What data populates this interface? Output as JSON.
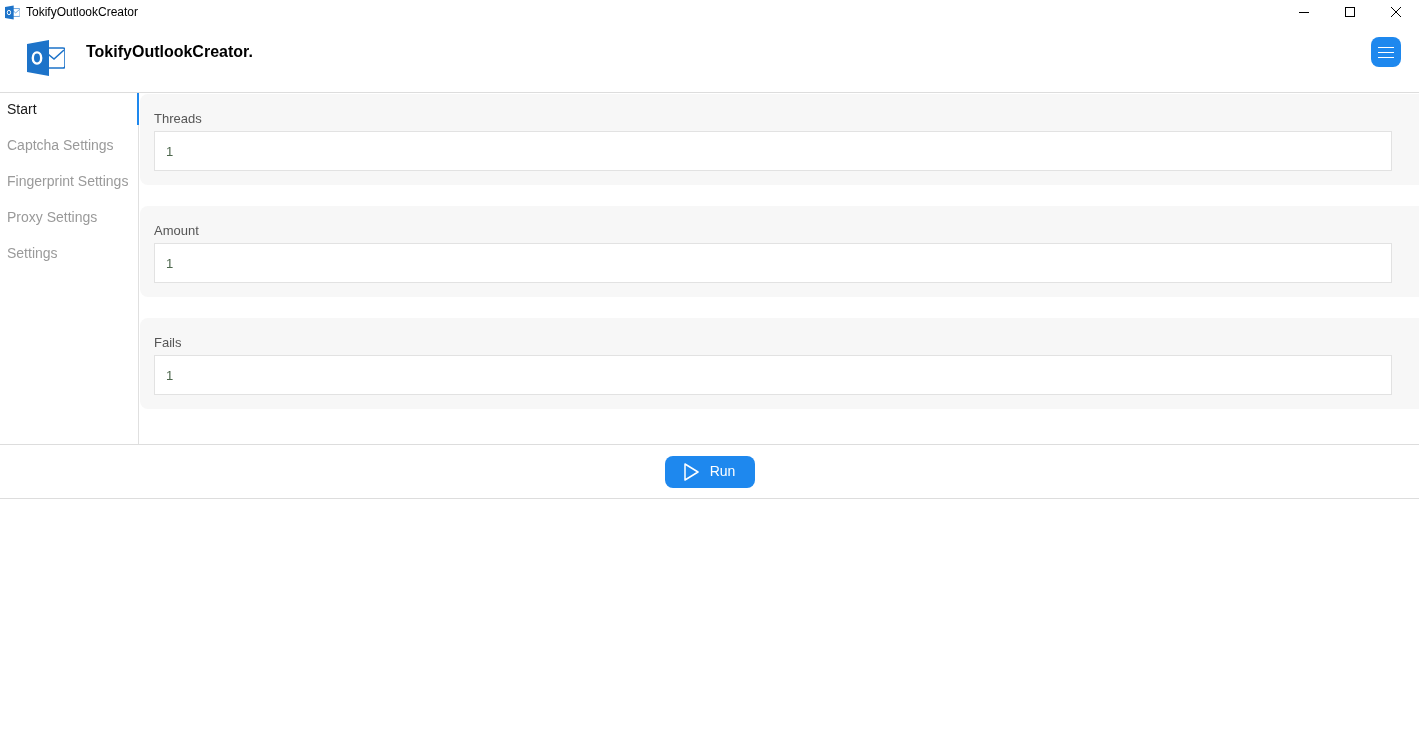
{
  "window": {
    "title": "TokifyOutlookCreator"
  },
  "header": {
    "app_name": "TokifyOutlookCreator."
  },
  "sidebar": {
    "items": [
      {
        "label": "Start",
        "selected": true
      },
      {
        "label": "Captcha Settings",
        "selected": false
      },
      {
        "label": "Fingerprint Settings",
        "selected": false
      },
      {
        "label": "Proxy Settings",
        "selected": false
      },
      {
        "label": "Settings",
        "selected": false
      }
    ]
  },
  "fields": [
    {
      "label": "Threads",
      "value": "1"
    },
    {
      "label": "Amount",
      "value": "1"
    },
    {
      "label": "Fails",
      "value": "1"
    }
  ],
  "run_button": {
    "label": "Run"
  }
}
